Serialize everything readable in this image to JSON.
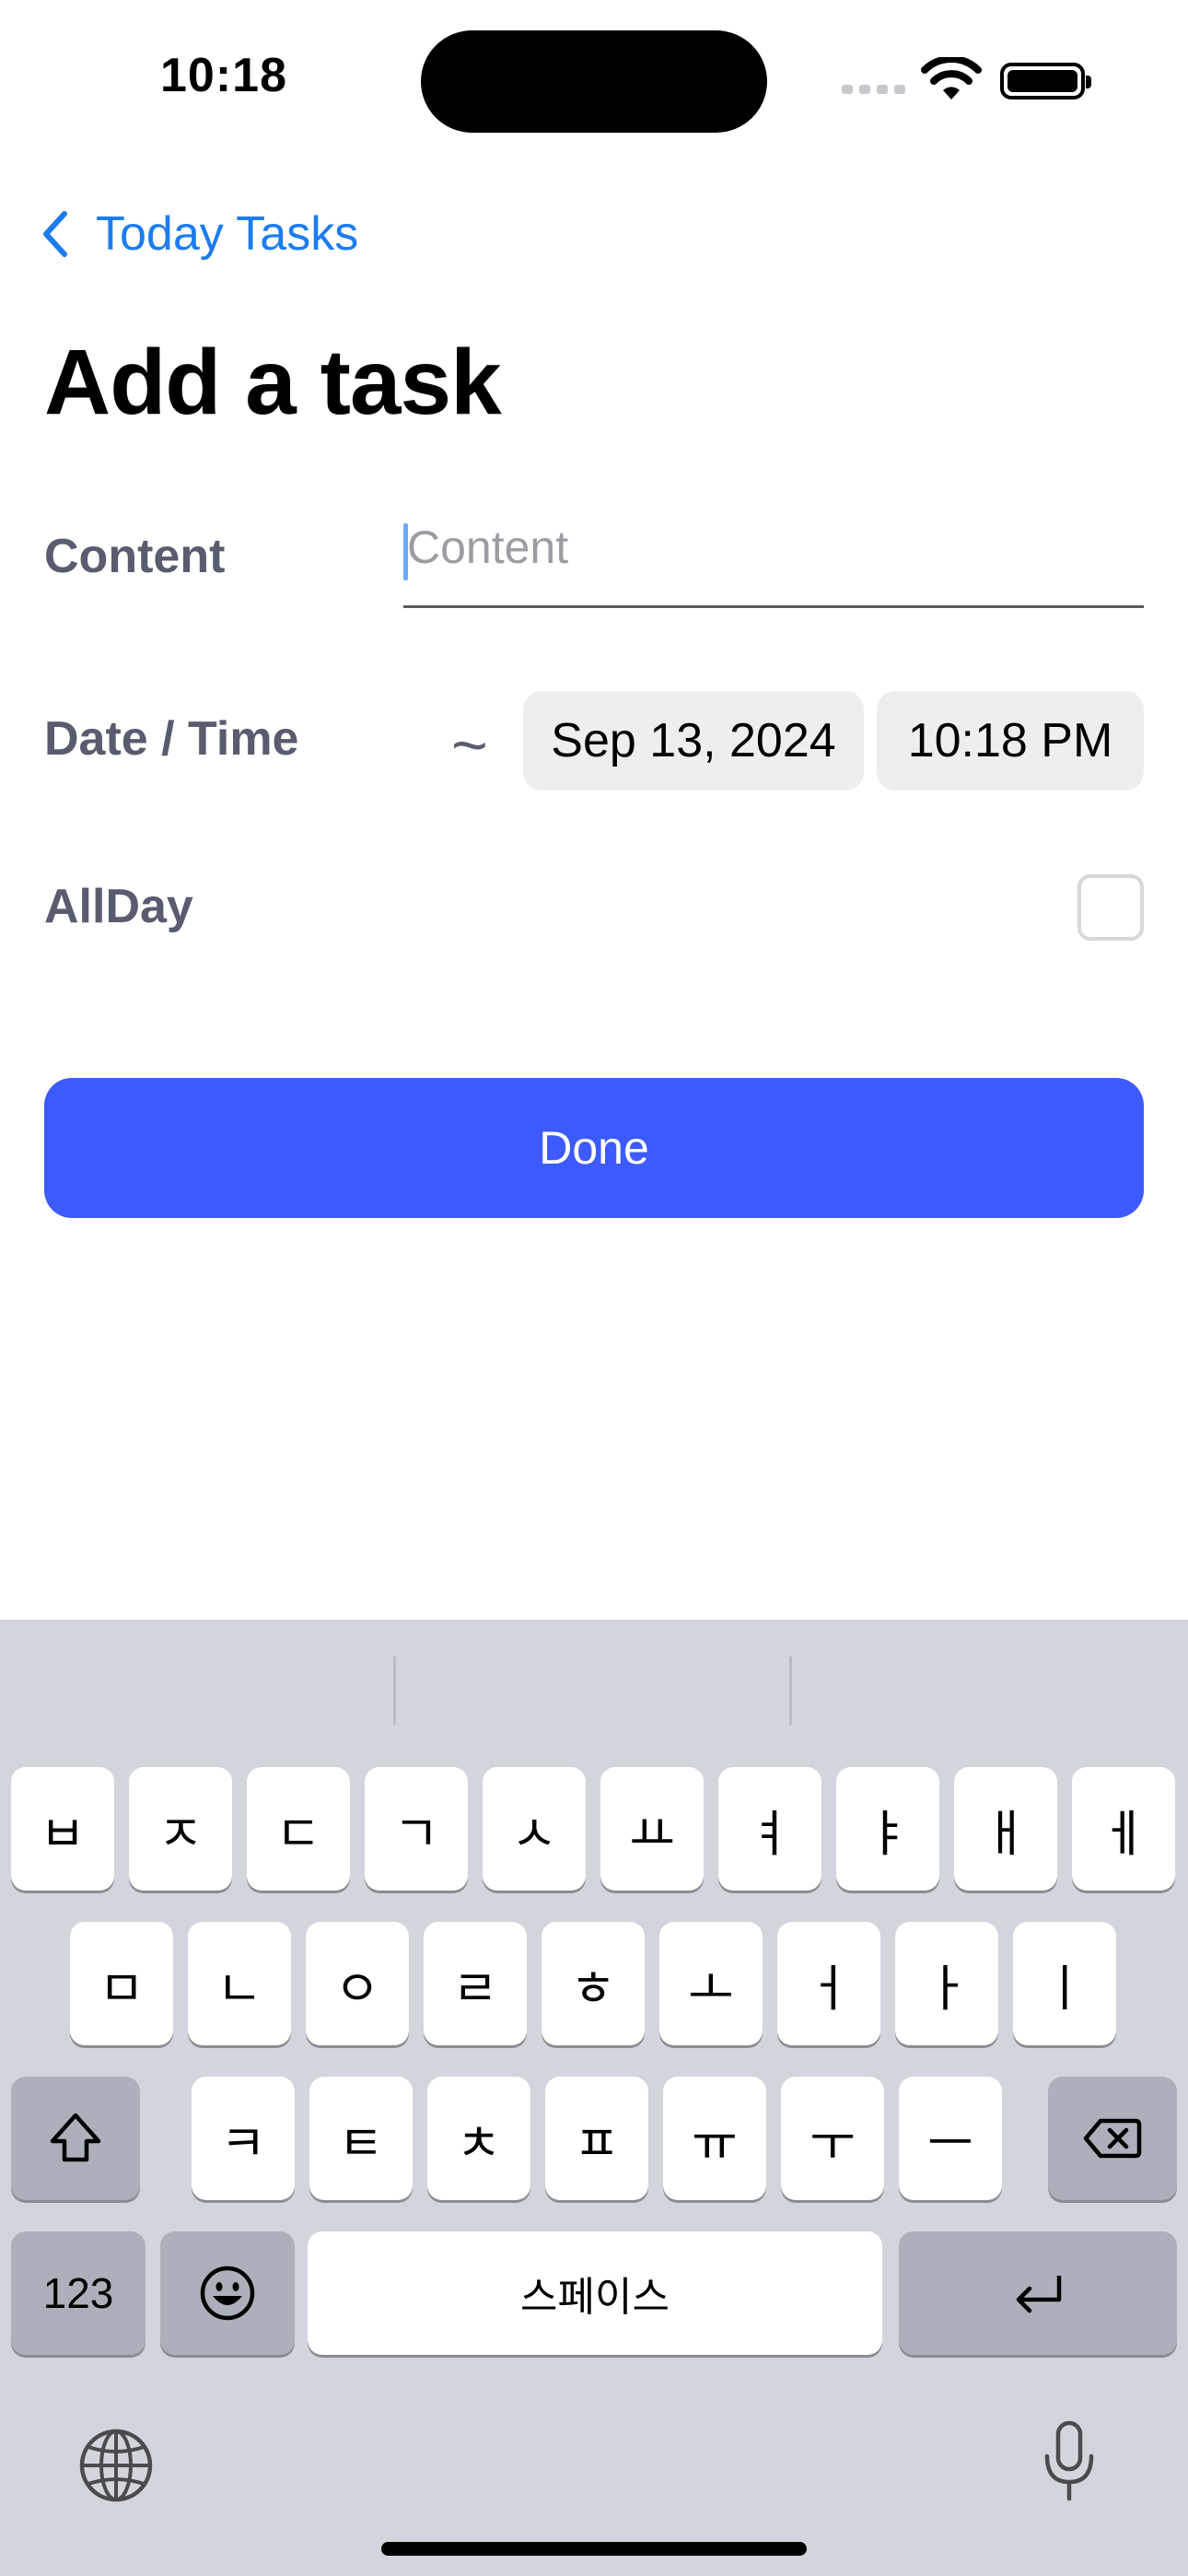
{
  "status_bar": {
    "time": "10:18"
  },
  "nav": {
    "back_label": "Today Tasks"
  },
  "page": {
    "title": "Add a task"
  },
  "form": {
    "content_label": "Content",
    "content_placeholder": "Content",
    "content_value": "",
    "datetime_label": "Date / Time",
    "range_symbol": "~",
    "date_value": "Sep 13, 2024",
    "time_value": "10:18 PM",
    "allday_label": "AllDay",
    "allday_checked": false
  },
  "done_button": {
    "label": "Done"
  },
  "keyboard": {
    "row1": [
      "ㅂ",
      "ㅈ",
      "ㄷ",
      "ㄱ",
      "ㅅ",
      "ㅛ",
      "ㅕ",
      "ㅑ",
      "ㅐ",
      "ㅔ"
    ],
    "row2": [
      "ㅁ",
      "ㄴ",
      "ㅇ",
      "ㄹ",
      "ㅎ",
      "ㅗ",
      "ㅓ",
      "ㅏ",
      "ㅣ"
    ],
    "row3": [
      "ㅋ",
      "ㅌ",
      "ㅊ",
      "ㅍ",
      "ㅠ",
      "ㅜ",
      "ㅡ"
    ],
    "numbers_label": "123",
    "space_label": "스페이스"
  },
  "icons": {
    "back": "chevron-left-icon",
    "wifi": "wifi-icon",
    "battery": "battery-icon",
    "shift": "shift-icon",
    "delete": "delete-icon",
    "emoji": "emoji-icon",
    "return": "return-icon",
    "globe": "globe-icon",
    "mic": "microphone-icon"
  },
  "colors": {
    "accent": "#1c7cf0",
    "done_button": "#3d5afe",
    "label": "#585c6e",
    "keyboard_bg": "#d2d5db"
  }
}
